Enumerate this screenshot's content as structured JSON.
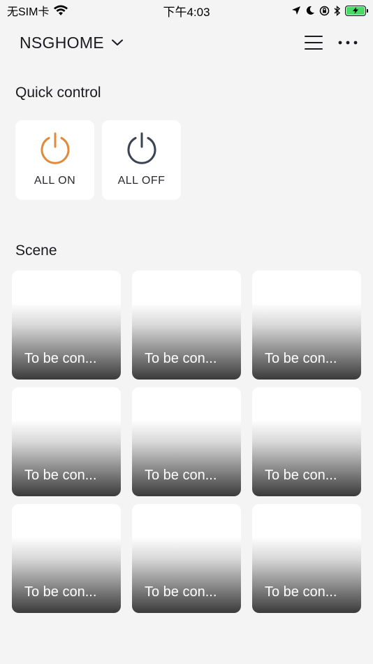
{
  "status_bar": {
    "carrier": "无SIM卡",
    "time": "下午4:03"
  },
  "header": {
    "home_name": "NSGHOME",
    "icons": [
      "chevron-down-icon",
      "menu-icon",
      "more-icon"
    ]
  },
  "quick_control": {
    "title": "Quick control",
    "items": [
      {
        "label": "ALL ON",
        "icon": "power-icon",
        "color": "#e08a3c"
      },
      {
        "label": "ALL OFF",
        "icon": "power-icon",
        "color": "#3a4452"
      }
    ]
  },
  "scene": {
    "title": "Scene",
    "items": [
      {
        "label": "To be con..."
      },
      {
        "label": "To be con..."
      },
      {
        "label": "To be con..."
      },
      {
        "label": "To be con..."
      },
      {
        "label": "To be con..."
      },
      {
        "label": "To be con..."
      },
      {
        "label": "To be con..."
      },
      {
        "label": "To be con..."
      },
      {
        "label": "To be con..."
      }
    ]
  }
}
